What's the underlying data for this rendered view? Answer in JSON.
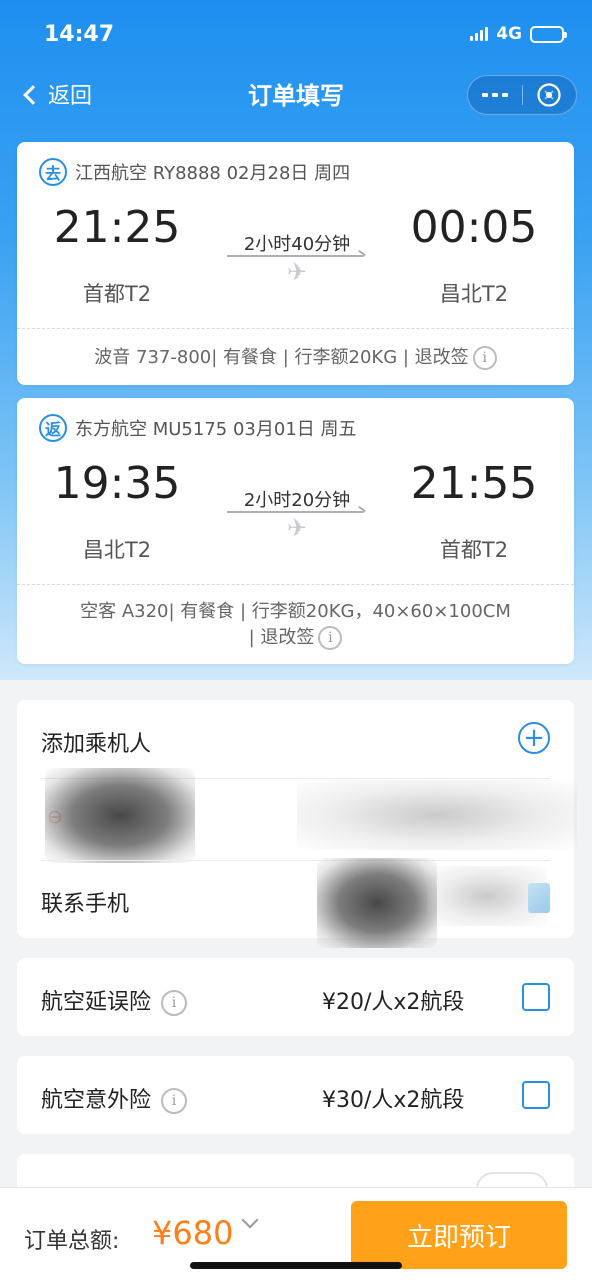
{
  "status_bar": {
    "time": "14:47",
    "network": "4G",
    "battery_fraction": 0.4
  },
  "nav": {
    "back_label": "返回",
    "title": "订单填写"
  },
  "outbound": {
    "badge": "去",
    "header": "江西航空 RY8888 02月28日 周四",
    "depart_time": "21:25",
    "arrive_time": "00:05",
    "duration": "2小时40分钟",
    "depart_airport": "首都T2",
    "arrive_airport": "昌北T2",
    "info": "波音 737-800| 有餐食 | 行李额20KG | 退改签"
  },
  "return": {
    "badge": "返",
    "header": "东方航空 MU5175 03月01日 周五",
    "depart_time": "19:35",
    "arrive_time": "21:55",
    "duration": "2小时20分钟",
    "depart_airport": "昌北T2",
    "arrive_airport": "首都T2",
    "info_line1": "空客 A320| 有餐食 | 行李额20KG，40×60×100CM",
    "info_line2": "| 退改签"
  },
  "passenger": {
    "add_label": "添加乘机人",
    "contact_label": "联系手机"
  },
  "insurance": [
    {
      "label": "航空延误险",
      "price": "¥20/人x2航段",
      "checked": false
    },
    {
      "label": "航空意外险",
      "price": "¥30/人x2航段",
      "checked": false
    }
  ],
  "bottom": {
    "total_label": "订单总额:",
    "total_price": "¥680",
    "book_label": "立即预订"
  },
  "colors": {
    "accent": "#2a8ee6",
    "price": "#ff7e16",
    "book_button": "#ffa21a"
  }
}
